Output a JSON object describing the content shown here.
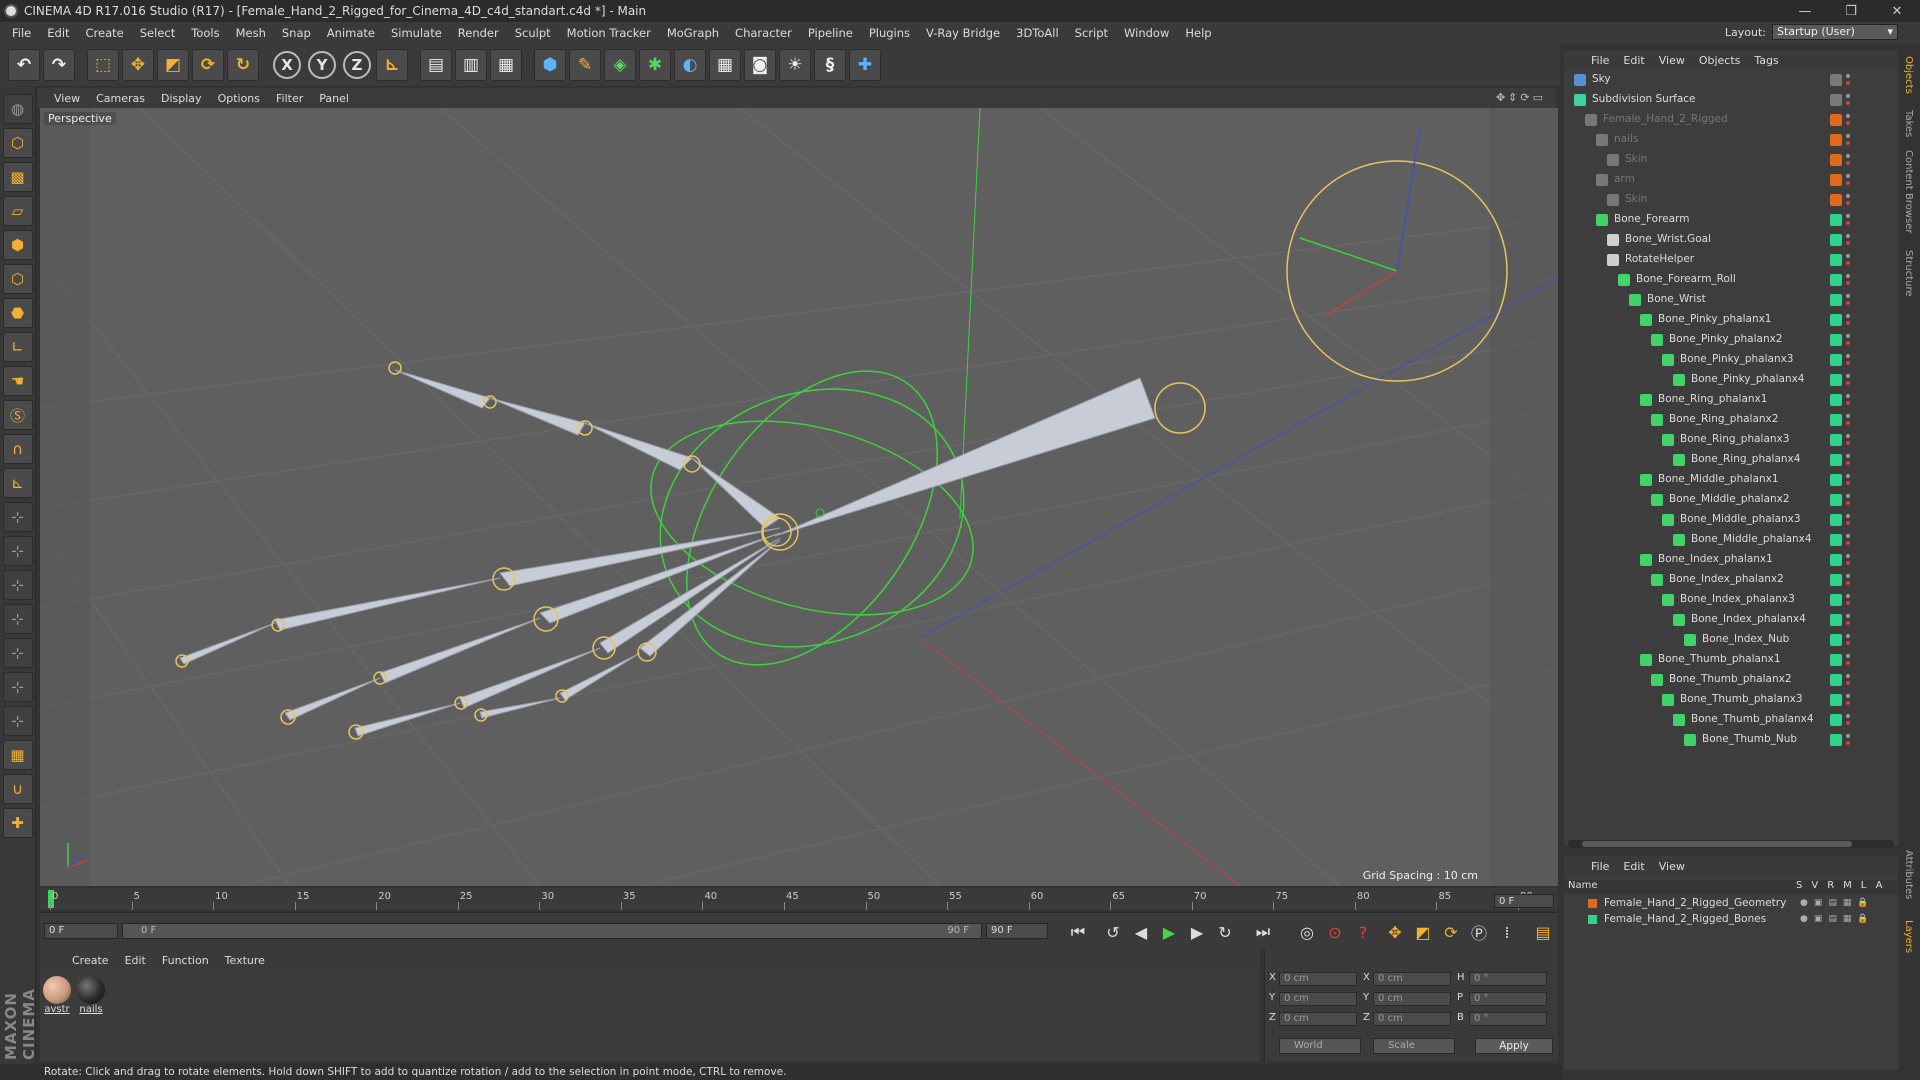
{
  "window": {
    "title": "CINEMA 4D R17.016 Studio (R17) - [Female_Hand_2_Rigged_for_Cinema_4D_c4d_standart.c4d *] - Main",
    "controls": [
      "—",
      "❐",
      "✕"
    ]
  },
  "menubar": {
    "items": [
      "File",
      "Edit",
      "Create",
      "Select",
      "Tools",
      "Mesh",
      "Snap",
      "Animate",
      "Simulate",
      "Render",
      "Sculpt",
      "Motion Tracker",
      "MoGraph",
      "Character",
      "Pipeline",
      "Plugins",
      "V-Ray Bridge",
      "3DToAll",
      "Script",
      "Window",
      "Help"
    ],
    "layout_label": "Layout:",
    "layout_value": "Startup (User)"
  },
  "toolbar": {
    "axis_x": "X",
    "axis_y": "Y",
    "axis_z": "Z",
    "icons": [
      "undo-icon",
      "redo-icon",
      "live-select-icon",
      "move-icon",
      "scale-icon",
      "rotate-icon",
      "recent-tool-icon",
      "x-axis-icon",
      "y-axis-icon",
      "z-axis-icon",
      "coordinate-system-icon",
      "render-view-icon",
      "render-picture-viewer-icon",
      "edit-render-settings-icon",
      "cube-icon",
      "pen-icon",
      "subdivision-icon",
      "cloner-icon",
      "deformer-icon",
      "floor-icon",
      "camera-icon",
      "light-icon",
      "python-script-icon",
      "python-icon"
    ]
  },
  "viewport": {
    "menu": [
      "View",
      "Cameras",
      "Display",
      "Options",
      "Filter",
      "Panel"
    ],
    "label": "Perspective",
    "grid_spacing": "Grid Spacing : 10 cm",
    "colors": {
      "background": "#5f5f5f",
      "bone": "#c7ccd6",
      "joint": "#e8c460",
      "controller": "#3ed13e",
      "axis_x": "#c44040",
      "axis_y": "#3ed13e",
      "axis_z": "#3f4fbf"
    }
  },
  "timeline": {
    "ticks": [
      "0",
      "5",
      "10",
      "15",
      "20",
      "25",
      "30",
      "35",
      "40",
      "45",
      "50",
      "55",
      "60",
      "65",
      "70",
      "75",
      "80",
      "85",
      "90"
    ],
    "current_frame": "0 F",
    "start_field": "0 F",
    "range_start": "0 F",
    "range_end": "90 F",
    "end_field": "90 F",
    "end_frame_display": "0 F"
  },
  "materials": {
    "menu": [
      "Create",
      "Edit",
      "Function",
      "Texture"
    ],
    "items": [
      {
        "name": "avstr",
        "color": "#c99a80"
      },
      {
        "name": "nails",
        "color": "#2a2a2a"
      }
    ]
  },
  "coordinates": {
    "rows": [
      {
        "axis": "X",
        "pos": "0 cm",
        "size_axis": "X",
        "size": "0 cm",
        "rot_axis": "H",
        "rot": "0 °"
      },
      {
        "axis": "Y",
        "pos": "0 cm",
        "size_axis": "Y",
        "size": "0 cm",
        "rot_axis": "P",
        "rot": "0 °"
      },
      {
        "axis": "Z",
        "pos": "0 cm",
        "size_axis": "Z",
        "size": "0 cm",
        "rot_axis": "B",
        "rot": "0 °"
      }
    ],
    "mode": "World",
    "size_mode": "Scale",
    "apply": "Apply"
  },
  "statusbar": {
    "text": "Rotate: Click and drag to rotate elements. Hold down SHIFT to add to quantize rotation / add to the selection in point mode, CTRL to remove."
  },
  "object_manager": {
    "menu": [
      "File",
      "Edit",
      "View",
      "Objects",
      "Tags"
    ],
    "objects": [
      {
        "name": "Sky",
        "depth": 0,
        "icon": "#5a8fd0",
        "tag": "#7a7a7a",
        "dim": false
      },
      {
        "name": "Subdivision Surface",
        "depth": 0,
        "icon": "#3fd3a0",
        "tag": "#7a7a7a",
        "dim": false
      },
      {
        "name": "Female_Hand_2_Rigged",
        "depth": 1,
        "icon": "#777777",
        "tag": "#e06a1a",
        "dim": true
      },
      {
        "name": "nails",
        "depth": 2,
        "icon": "#777777",
        "tag": "#e06a1a",
        "dim": true
      },
      {
        "name": "Skin",
        "depth": 3,
        "icon": "#777777",
        "tag": "#e06a1a",
        "dim": true
      },
      {
        "name": "arm",
        "depth": 2,
        "icon": "#777777",
        "tag": "#e06a1a",
        "dim": true
      },
      {
        "name": "Skin",
        "depth": 3,
        "icon": "#777777",
        "tag": "#e06a1a",
        "dim": true
      },
      {
        "name": "Bone_Forearm",
        "depth": 2,
        "icon": "#3fd36a",
        "tag": "#2fd38a",
        "dim": false
      },
      {
        "name": "Bone_Wrist.Goal",
        "depth": 3,
        "icon": "#cfcfcf",
        "tag": "#2fd38a",
        "dim": false
      },
      {
        "name": "RotateHelper",
        "depth": 3,
        "icon": "#cfcfcf",
        "tag": "#2fd38a",
        "dim": false
      },
      {
        "name": "Bone_Forearm_Roll",
        "depth": 4,
        "icon": "#3fd36a",
        "tag": "#2fd38a",
        "dim": false
      },
      {
        "name": "Bone_Wrist",
        "depth": 5,
        "icon": "#3fd36a",
        "tag": "#2fd38a",
        "dim": false
      },
      {
        "name": "Bone_Pinky_phalanx1",
        "depth": 6,
        "icon": "#3fd36a",
        "tag": "#2fd38a",
        "dim": false
      },
      {
        "name": "Bone_Pinky_phalanx2",
        "depth": 7,
        "icon": "#3fd36a",
        "tag": "#2fd38a",
        "dim": false
      },
      {
        "name": "Bone_Pinky_phalanx3",
        "depth": 8,
        "icon": "#3fd36a",
        "tag": "#2fd38a",
        "dim": false
      },
      {
        "name": "Bone_Pinky_phalanx4",
        "depth": 9,
        "icon": "#3fd36a",
        "tag": "#2fd38a",
        "dim": false
      },
      {
        "name": "Bone_Ring_phalanx1",
        "depth": 6,
        "icon": "#3fd36a",
        "tag": "#2fd38a",
        "dim": false
      },
      {
        "name": "Bone_Ring_phalanx2",
        "depth": 7,
        "icon": "#3fd36a",
        "tag": "#2fd38a",
        "dim": false
      },
      {
        "name": "Bone_Ring_phalanx3",
        "depth": 8,
        "icon": "#3fd36a",
        "tag": "#2fd38a",
        "dim": false
      },
      {
        "name": "Bone_Ring_phalanx4",
        "depth": 9,
        "icon": "#3fd36a",
        "tag": "#2fd38a",
        "dim": false
      },
      {
        "name": "Bone_Middle_phalanx1",
        "depth": 6,
        "icon": "#3fd36a",
        "tag": "#2fd38a",
        "dim": false
      },
      {
        "name": "Bone_Middle_phalanx2",
        "depth": 7,
        "icon": "#3fd36a",
        "tag": "#2fd38a",
        "dim": false
      },
      {
        "name": "Bone_Middle_phalanx3",
        "depth": 8,
        "icon": "#3fd36a",
        "tag": "#2fd38a",
        "dim": false
      },
      {
        "name": "Bone_Middle_phalanx4",
        "depth": 9,
        "icon": "#3fd36a",
        "tag": "#2fd38a",
        "dim": false
      },
      {
        "name": "Bone_Index_phalanx1",
        "depth": 6,
        "icon": "#3fd36a",
        "tag": "#2fd38a",
        "dim": false
      },
      {
        "name": "Bone_Index_phalanx2",
        "depth": 7,
        "icon": "#3fd36a",
        "tag": "#2fd38a",
        "dim": false
      },
      {
        "name": "Bone_Index_phalanx3",
        "depth": 8,
        "icon": "#3fd36a",
        "tag": "#2fd38a",
        "dim": false
      },
      {
        "name": "Bone_Index_phalanx4",
        "depth": 9,
        "icon": "#3fd36a",
        "tag": "#2fd38a",
        "dim": false
      },
      {
        "name": "Bone_Index_Nub",
        "depth": 10,
        "icon": "#3fd36a",
        "tag": "#2fd38a",
        "dim": false
      },
      {
        "name": "Bone_Thumb_phalanx1",
        "depth": 6,
        "icon": "#3fd36a",
        "tag": "#2fd38a",
        "dim": false
      },
      {
        "name": "Bone_Thumb_phalanx2",
        "depth": 7,
        "icon": "#3fd36a",
        "tag": "#2fd38a",
        "dim": false
      },
      {
        "name": "Bone_Thumb_phalanx3",
        "depth": 8,
        "icon": "#3fd36a",
        "tag": "#2fd38a",
        "dim": false
      },
      {
        "name": "Bone_Thumb_phalanx4",
        "depth": 9,
        "icon": "#3fd36a",
        "tag": "#2fd38a",
        "dim": false
      },
      {
        "name": "Bone_Thumb_Nub",
        "depth": 10,
        "icon": "#3fd36a",
        "tag": "#2fd38a",
        "dim": false
      }
    ]
  },
  "layer_manager": {
    "menu": [
      "File",
      "Edit",
      "View"
    ],
    "header_name": "Name",
    "header_cols": "SVRMLA",
    "layers": [
      {
        "name": "Female_Hand_2_Rigged_Geometry",
        "color": "#e06a1a"
      },
      {
        "name": "Female_Hand_2_Rigged_Bones",
        "color": "#2fd38a"
      }
    ]
  },
  "side_tabs": [
    "Objects",
    "Takes",
    "Content Browser",
    "Structure",
    "Attributes",
    "Layers"
  ]
}
